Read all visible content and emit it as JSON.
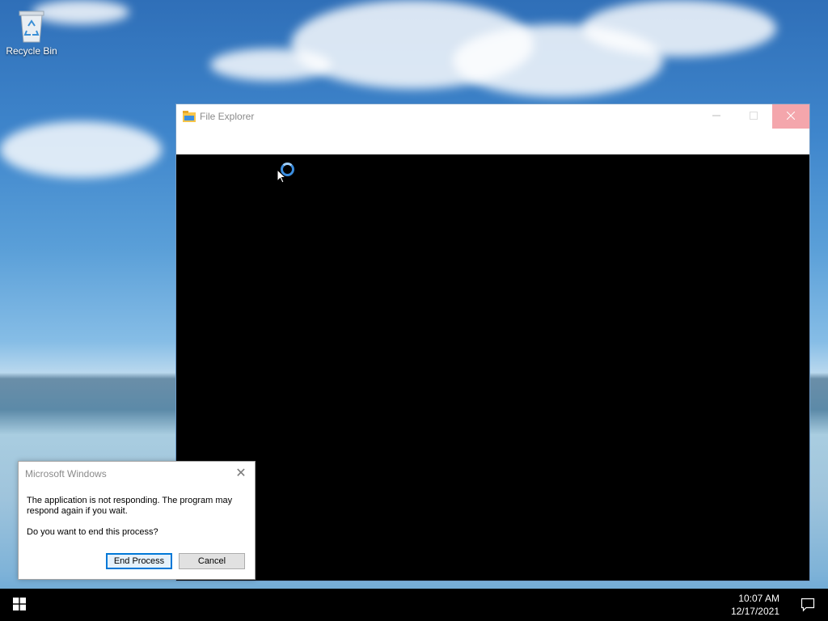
{
  "desktop": {
    "recycle_bin_label": "Recycle Bin"
  },
  "explorer": {
    "title": "File Explorer",
    "icons": {
      "app": "folder-icon",
      "minimize": "minimize-icon",
      "maximize": "maximize-icon",
      "close": "close-icon"
    },
    "status": "not-responding"
  },
  "dialog": {
    "title": "Microsoft Windows",
    "message": "The application is not responding. The program may respond again if you wait.",
    "question": "Do you want to end this process?",
    "end_label": "End Process",
    "cancel_label": "Cancel"
  },
  "taskbar": {
    "time": "10:07 AM",
    "date": "12/17/2021",
    "start_icon": "windows-logo-icon",
    "notification_icon": "action-center-icon"
  },
  "colors": {
    "accent": "#0078d7",
    "close_hover": "#f4a6ac",
    "taskbar": "#000000"
  }
}
